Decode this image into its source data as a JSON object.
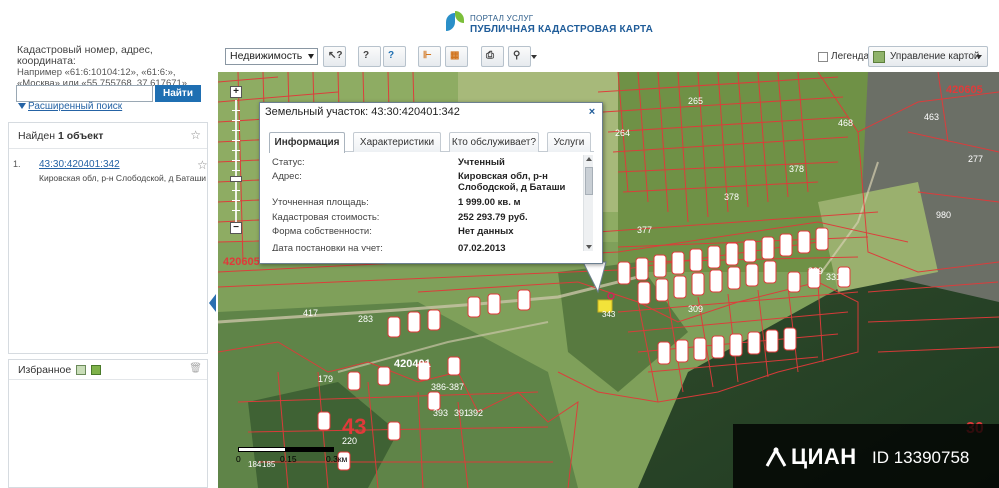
{
  "header": {
    "logo_line1": "ПОРТАЛ УСЛУГ",
    "logo_line2": "ПУБЛИЧНАЯ КАДАСТРОВАЯ КАРТА"
  },
  "search": {
    "hint_title": "Кадастровый номер, адрес, координата:",
    "hint_line1": "Например «61:6:10104:12», «61:6:»,",
    "hint_line2": "«Москва» или «55.755768, 37.617671»",
    "value": "",
    "placeholder": "",
    "button_label": "Найти",
    "advanced_label": "Расширенный поиск"
  },
  "results": {
    "found_prefix": "Найден ",
    "found_count": "1 объект",
    "items": [
      {
        "number": "1.",
        "cadastral": "43:30:420401:342",
        "address": "Кировская обл, р-н Слободской, д Баташи"
      }
    ]
  },
  "favorites": {
    "label": "Избранное"
  },
  "toolbar": {
    "realty_select": "Недвижимость",
    "legend_label": "Легенда",
    "map_control_label": "Управление картой"
  },
  "popup": {
    "title": "Земельный участок: 43:30:420401:342",
    "tabs": [
      "Информация",
      "Характеристики",
      "Кто обслуживает?",
      "Услуги"
    ],
    "rows": [
      {
        "key": "Статус:",
        "value": "Учтенный"
      },
      {
        "key": "Адрес:",
        "value": "Кировская обл, р-н Слободской, д Баташи"
      },
      {
        "key": "Уточненная площадь:",
        "value": "1 999.00 кв. м"
      },
      {
        "key": "Кадастровая стоимость:",
        "value": "252 293.79 руб."
      },
      {
        "key": "Форма собственности:",
        "value": "Нет данных"
      },
      {
        "key": "Дата постановки на учет:",
        "value": "07.02.2013"
      }
    ]
  },
  "map": {
    "labels": {
      "q420605_right": "420605",
      "q420605_left": "420605",
      "q420401": "420401",
      "n43": "43",
      "n30": "30"
    },
    "parcels": [
      "265",
      "264",
      "468",
      "463",
      "277",
      "378",
      "378",
      "980",
      "377",
      "309",
      "331",
      "417",
      "283",
      "343",
      "309",
      "179",
      "386-387",
      "393",
      "391",
      "392",
      "220",
      "184",
      "185"
    ],
    "scale_labels": [
      "0",
      "0.15",
      "0.3км"
    ]
  },
  "watermark": {
    "brand": "ЦИАН",
    "id": "ID 13390758"
  },
  "colors": {
    "accent": "#1f6fb2",
    "parcel_lines": "#e03a3a",
    "selected_parcel": "#f2e33a"
  }
}
